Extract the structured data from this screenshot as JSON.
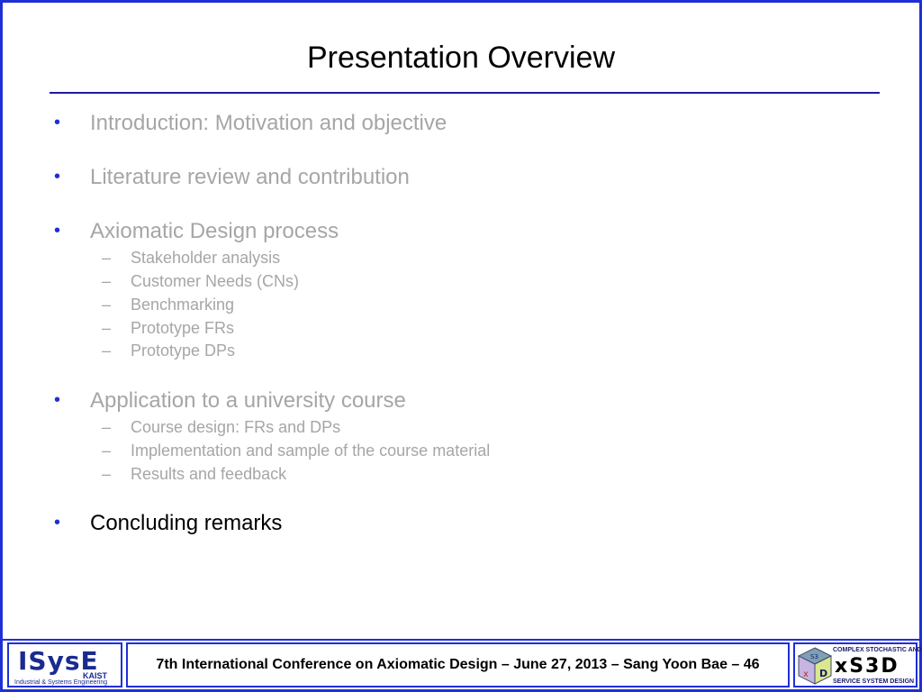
{
  "slide": {
    "title": "Presentation Overview"
  },
  "outline": {
    "bullet_glyph": "•",
    "dash_glyph": "–",
    "items": [
      {
        "label": "Introduction: Motivation and objective",
        "active": false
      },
      {
        "label": "Literature review and contribution",
        "active": false
      },
      {
        "label": "Axiomatic Design process",
        "active": false,
        "subitems": [
          "Stakeholder analysis",
          "Customer Needs (CNs)",
          "Benchmarking",
          "Prototype FRs",
          "Prototype DPs"
        ]
      },
      {
        "label": "Application to a university course",
        "active": false,
        "subitems": [
          "Course design: FRs and DPs",
          "Implementation and sample of the course material",
          "Results and feedback"
        ]
      },
      {
        "label": "Concluding remarks",
        "active": true
      }
    ]
  },
  "footer": {
    "text": "7th International Conference on Axiomatic Design – June 27, 2013 – Sang Yoon Bae – 46",
    "left_logo": {
      "word": "ISysE",
      "sub_word": "KAIST",
      "tagline": "Industrial & Systems Engineering"
    },
    "right_logo": {
      "top_line": "COMPLEX STOCHASTIC AND",
      "word": "xS3D",
      "bottom_line": "SERVICE SYSTEM DESIGN",
      "cube_letters": [
        "S3",
        "D",
        "x"
      ]
    }
  },
  "colors": {
    "accent": "#1f2fd6",
    "rule": "#1c1c9e",
    "dimmed_text": "#a6a6a6",
    "active_text": "#000000"
  }
}
